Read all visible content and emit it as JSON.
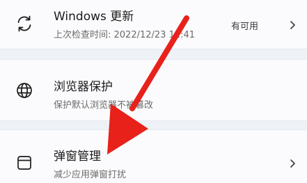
{
  "items": [
    {
      "title": "Windows 更新",
      "subtitle": "上次检查时间: 2022/12/23 11:41",
      "status": "有可用",
      "icon": "sync-icon"
    },
    {
      "title": "浏览器保护",
      "subtitle": "保护默认浏览器不被篡改",
      "icon": "globe-icon"
    },
    {
      "title": "弹窗管理",
      "subtitle": "减少应用弹窗打扰",
      "icon": "window-icon"
    }
  ],
  "colors": {
    "background": "#eef2f7",
    "card": "#fbfbfd",
    "arrow": "#e8211b",
    "text": "#1b1b1b",
    "subtext": "#6b6b6b"
  }
}
